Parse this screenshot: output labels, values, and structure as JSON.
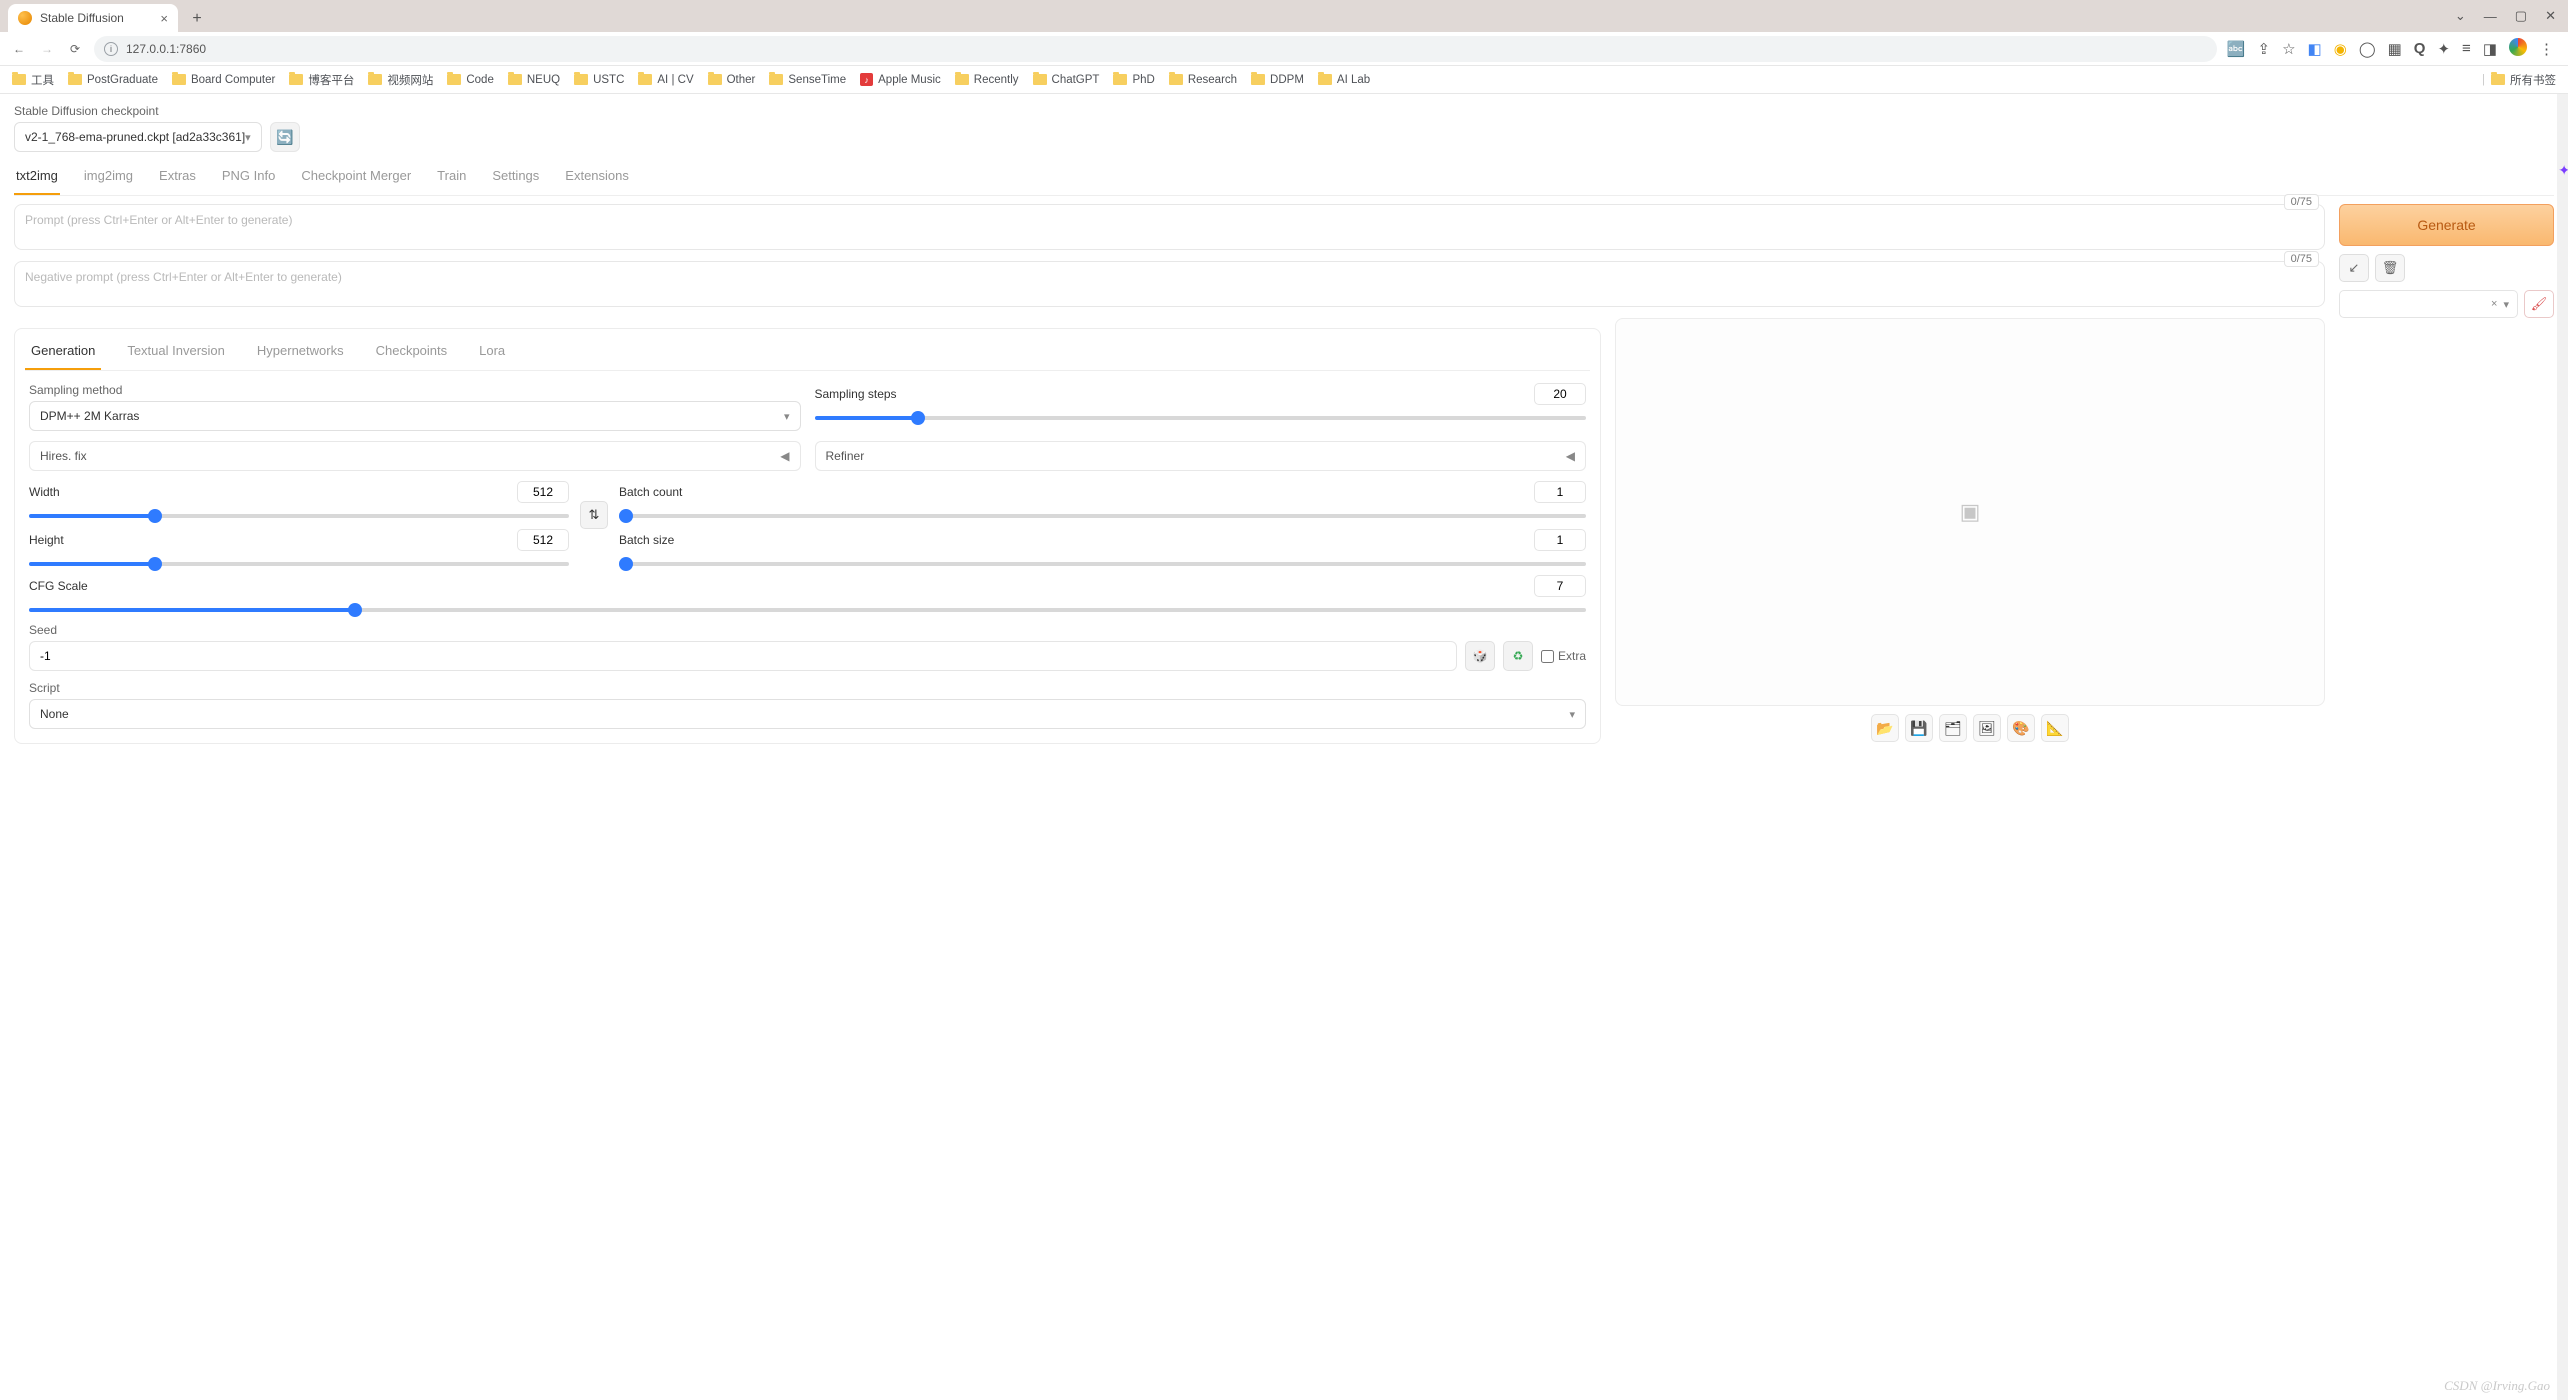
{
  "browser": {
    "tab_title": "Stable Diffusion",
    "url": "127.0.0.1:7860",
    "bookmarks": [
      "工具",
      "PostGraduate",
      "Board Computer",
      "博客平台",
      "视频网站",
      "Code",
      "NEUQ",
      "USTC",
      "AI | CV",
      "Other",
      "SenseTime",
      "Apple Music",
      "Recently",
      "ChatGPT",
      "PhD",
      "Research",
      "DDPM",
      "AI Lab"
    ],
    "all_bookmarks_label": "所有书签"
  },
  "checkpoint": {
    "label": "Stable Diffusion checkpoint",
    "value": "v2-1_768-ema-pruned.ckpt [ad2a33c361]"
  },
  "main_tabs": [
    "txt2img",
    "img2img",
    "Extras",
    "PNG Info",
    "Checkpoint Merger",
    "Train",
    "Settings",
    "Extensions"
  ],
  "prompt": {
    "placeholder": "Prompt (press Ctrl+Enter or Alt+Enter to generate)",
    "counter": "0/75"
  },
  "neg_prompt": {
    "placeholder": "Negative prompt (press Ctrl+Enter or Alt+Enter to generate)",
    "counter": "0/75"
  },
  "generate_label": "Generate",
  "subtabs": [
    "Generation",
    "Textual Inversion",
    "Hypernetworks",
    "Checkpoints",
    "Lora"
  ],
  "sampling_method": {
    "label": "Sampling method",
    "value": "DPM++ 2M Karras"
  },
  "sampling_steps": {
    "label": "Sampling steps",
    "value": 20,
    "min": 1,
    "max": 150
  },
  "hires": {
    "label": "Hires. fix"
  },
  "refiner": {
    "label": "Refiner"
  },
  "width": {
    "label": "Width",
    "value": 512,
    "min": 64,
    "max": 2048
  },
  "height": {
    "label": "Height",
    "value": 512,
    "min": 64,
    "max": 2048
  },
  "batch_count": {
    "label": "Batch count",
    "value": 1,
    "min": 1,
    "max": 100
  },
  "batch_size": {
    "label": "Batch size",
    "value": 1,
    "min": 1,
    "max": 8
  },
  "cfg": {
    "label": "CFG Scale",
    "value": 7,
    "min": 1,
    "max": 30
  },
  "seed": {
    "label": "Seed",
    "value": "-1",
    "extra_label": "Extra"
  },
  "script": {
    "label": "Script",
    "value": "None"
  },
  "watermark": "CSDN @Irving.Gao"
}
